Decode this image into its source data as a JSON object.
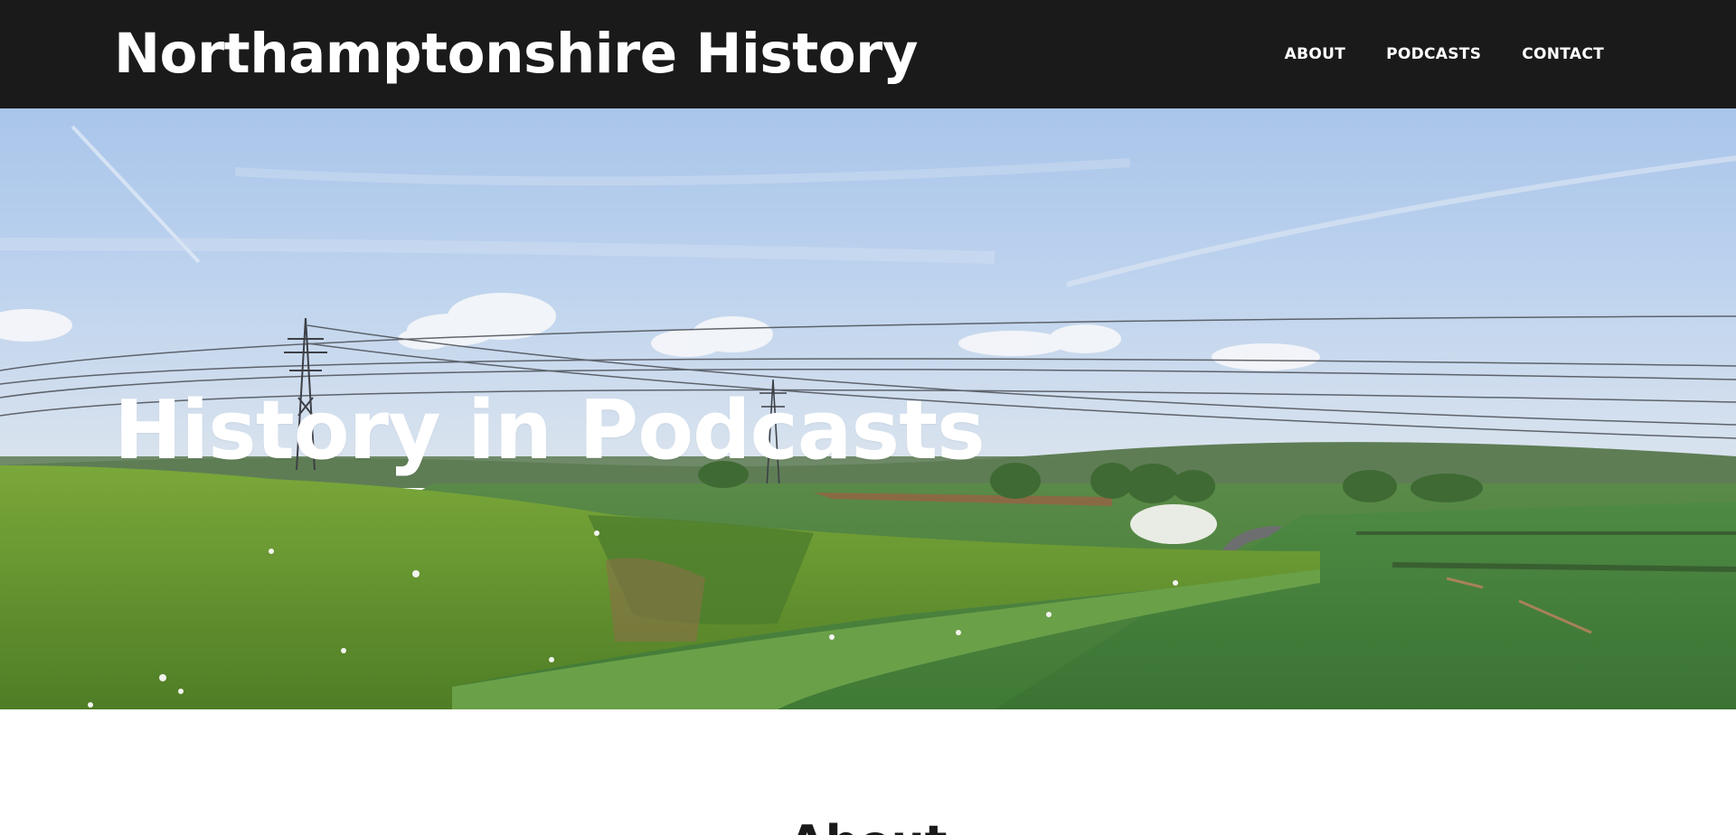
{
  "header": {
    "site_title": "Northamptonshire History",
    "nav": [
      {
        "label": "ABOUT"
      },
      {
        "label": "PODCASTS"
      },
      {
        "label": "CONTACT"
      }
    ]
  },
  "hero": {
    "title": "History in Podcasts",
    "image": "countryside-landscape-photo"
  },
  "about": {
    "heading": "About"
  },
  "colors": {
    "header_bg": "#1a1a1a",
    "header_text": "#ffffff",
    "hero_text": "#ffffff",
    "page_bg": "#ffffff"
  }
}
